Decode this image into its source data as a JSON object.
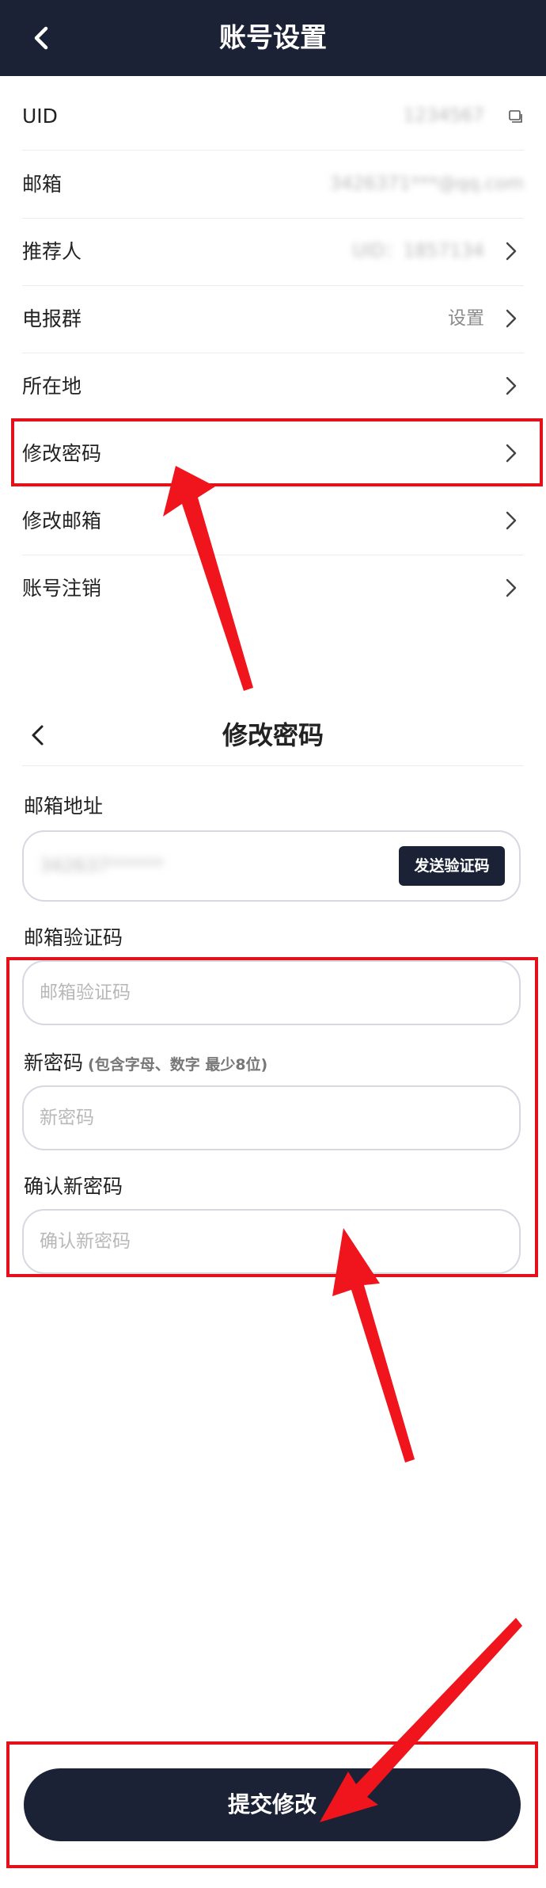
{
  "header": {
    "title": "账号设置"
  },
  "settings": {
    "uid_label": "UID",
    "uid_value": "1234567",
    "email_label": "邮箱",
    "email_value": "3426371***@qq.com",
    "referrer_label": "推荐人",
    "referrer_value": "UID：1857134",
    "telegram_label": "电报群",
    "telegram_value": "设置",
    "location_label": "所在地",
    "change_password_label": "修改密码",
    "change_email_label": "修改邮箱",
    "delete_account_label": "账号注销"
  },
  "password_page": {
    "title": "修改密码",
    "email_address_label": "邮箱地址",
    "email_address_value": "342637******",
    "send_code_label": "发送验证码",
    "email_code_label": "邮箱验证码",
    "email_code_placeholder": "邮箱验证码",
    "new_password_label": "新密码",
    "new_password_hint": "(包含字母、数字 最少8位)",
    "new_password_placeholder": "新密码",
    "confirm_password_label": "确认新密码",
    "confirm_password_placeholder": "确认新密码",
    "submit_label": "提交修改"
  },
  "colors": {
    "header_bg": "#1b2236",
    "highlight": "#e4111a",
    "button_bg": "#1b2236"
  }
}
